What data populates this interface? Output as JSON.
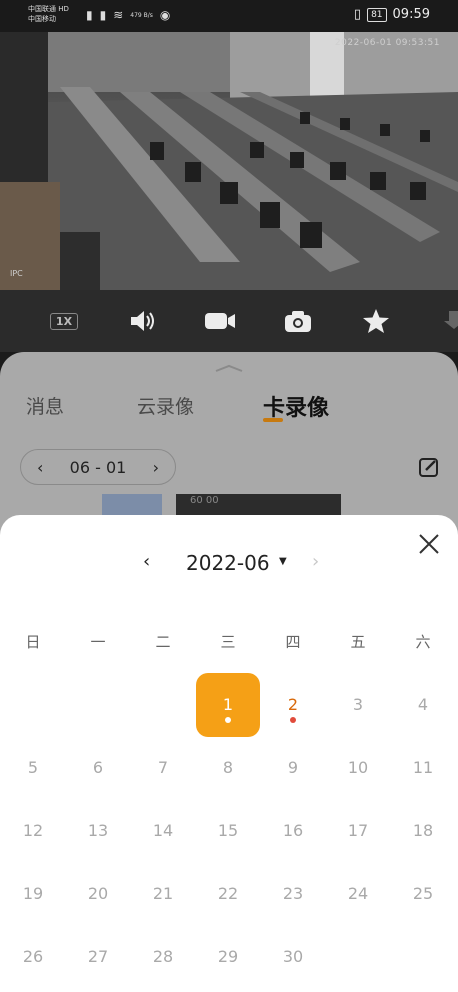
{
  "status_bar": {
    "carrier1": "中国联通 HD",
    "carrier2": "中国移动",
    "net_speed": "479 B/s",
    "battery": "81",
    "time": "09:59"
  },
  "video": {
    "osd_timestamp": "2022-06-01 09:53:51",
    "camera_label": "IPC"
  },
  "toolbar": {
    "speed_label": "1X",
    "items": [
      "speed",
      "volume",
      "record",
      "snapshot",
      "favorite",
      "download"
    ]
  },
  "tabs": [
    {
      "label": "消息",
      "active": false
    },
    {
      "label": "云录像",
      "active": false
    },
    {
      "label": "卡录像",
      "active": true
    }
  ],
  "date_selector": {
    "prev": "‹",
    "value": "06 - 01",
    "next": "›"
  },
  "timeline": {
    "thumb_label": "60 00"
  },
  "calendar": {
    "month_label": "2022-06",
    "caret": "▼",
    "prev": "‹",
    "next": "›",
    "weekdays": [
      "日",
      "一",
      "二",
      "三",
      "四",
      "五",
      "六"
    ],
    "selected_day": "1",
    "days_with_recordings": [
      "1",
      "2"
    ],
    "first_weekday_index": 3,
    "days": [
      "1",
      "2",
      "3",
      "4",
      "5",
      "6",
      "7",
      "8",
      "9",
      "10",
      "11",
      "12",
      "13",
      "14",
      "15",
      "16",
      "17",
      "18",
      "19",
      "20",
      "21",
      "22",
      "23",
      "24",
      "25",
      "26",
      "27",
      "28",
      "29",
      "30"
    ]
  },
  "colors": {
    "accent": "#f5a016",
    "recording_dot": "#e14b3b",
    "tab_underline": "#c77a10"
  }
}
